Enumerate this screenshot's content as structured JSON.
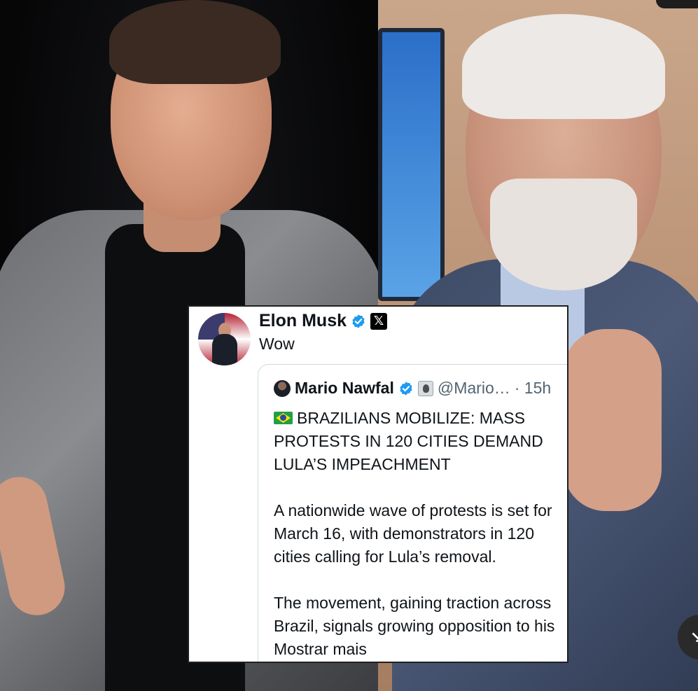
{
  "tweet": {
    "author": {
      "name": "Elon Musk",
      "verified_icon": "verified-badge-icon",
      "platform_icon": "x-logo-icon",
      "platform_glyph": "𝕏"
    },
    "text": "Wow",
    "quoted": {
      "author": {
        "name": "Mario Nawfal",
        "handle": "@Mario…",
        "time": "· 15h"
      },
      "headline": "BRAZILIANS MOBILIZE: MASS PROTESTS IN 120 CITIES DEMAND LULA’S IMPEACHMENT",
      "paragraph1": "A nationwide wave of protests is set for March 16, with demonstrators in 120 cities calling for Lula’s removal.",
      "paragraph2": "The movement, gaining traction across Brazil, signals growing opposition to his",
      "more_link": "Mostrar mais"
    }
  },
  "overlay": {
    "button_glyph": "↘"
  },
  "colors": {
    "link_text": "#0f1419",
    "verified_blue": "#1d9bf0",
    "card_border": "#202020"
  }
}
